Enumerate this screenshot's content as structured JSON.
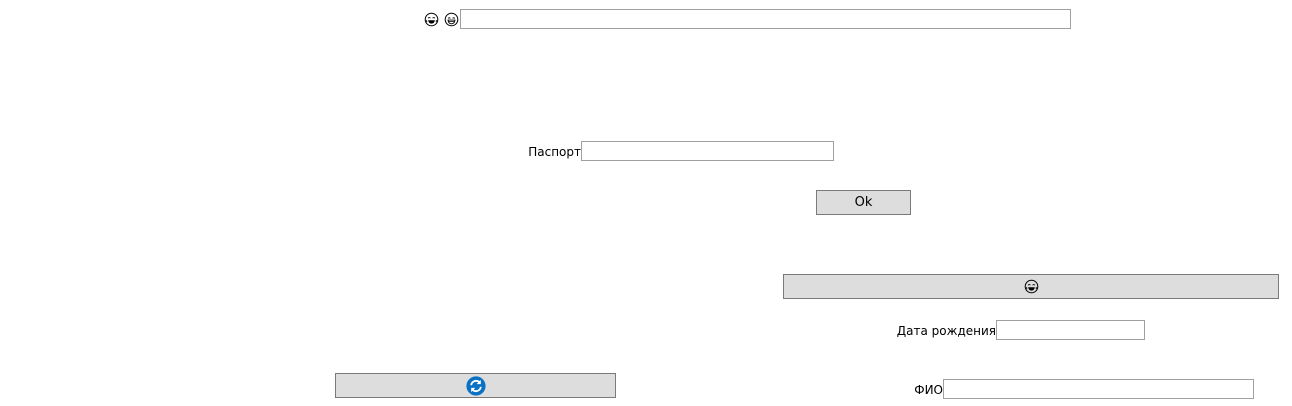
{
  "top": {
    "icons": [
      "laughing-face-icon",
      "grinning-face-icon"
    ],
    "input_value": ""
  },
  "passport": {
    "label": "Паспорт",
    "value": ""
  },
  "ok_button": {
    "label": "Ok"
  },
  "wide_button": {
    "icon": "laughing-face-icon"
  },
  "birth_date": {
    "label": "Дата рождения",
    "value": ""
  },
  "refresh_button": {
    "icon": "refresh-icon",
    "icon_color": "#0a72c4"
  },
  "full_name": {
    "label": "ФИО",
    "value": ""
  },
  "colors": {
    "button_bg": "#dddddd",
    "button_border": "#7a7a7a",
    "input_border": "#a0a0a0"
  }
}
